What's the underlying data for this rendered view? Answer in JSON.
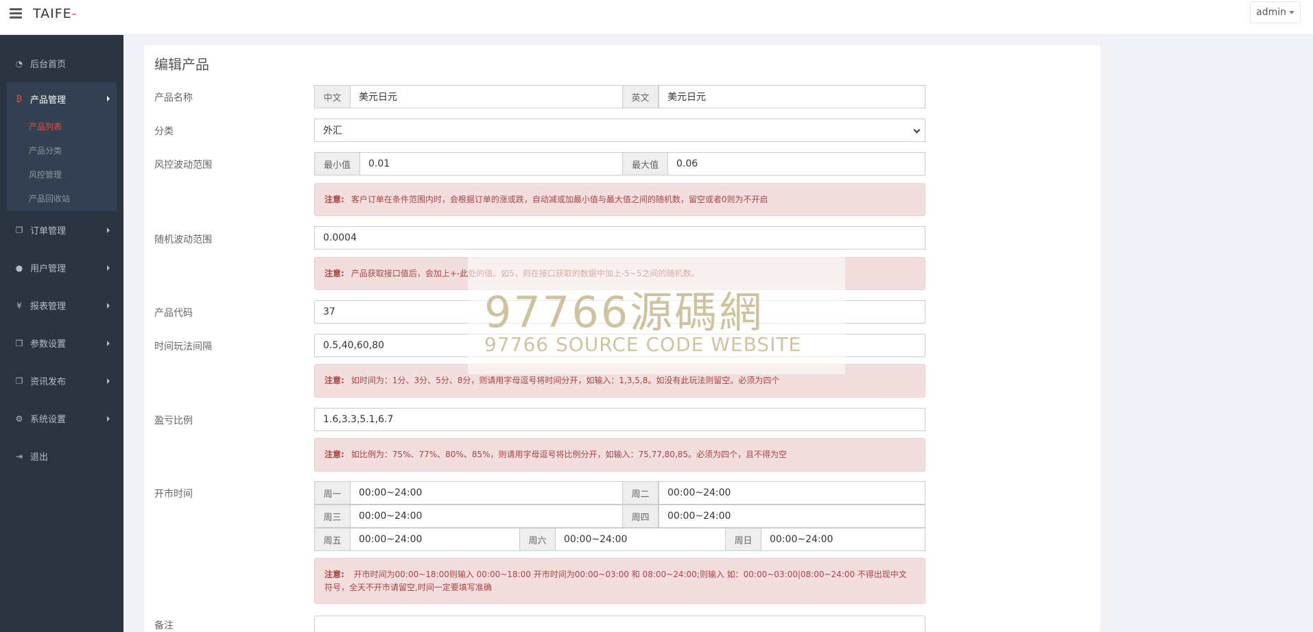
{
  "header": {
    "brand": "TAIFE",
    "brand_dash": "-",
    "user": "admin"
  },
  "sidebar": {
    "items": [
      {
        "label": "后台首页",
        "icon": "dashboard-icon"
      },
      {
        "label": "产品管理",
        "icon": "bitcoin-icon"
      },
      {
        "label": "订单管理",
        "icon": "copy-icon"
      },
      {
        "label": "用户管理",
        "icon": "user-icon"
      },
      {
        "label": "报表管理",
        "icon": "yen-icon"
      },
      {
        "label": "参数设置",
        "icon": "copy-icon"
      },
      {
        "label": "资讯发布",
        "icon": "copy-icon"
      },
      {
        "label": "系统设置",
        "icon": "cogs-icon"
      },
      {
        "label": "退出",
        "icon": "signout-icon"
      }
    ],
    "product_sub": [
      "产品列表",
      "产品分类",
      "风控管理",
      "产品回收站"
    ]
  },
  "form": {
    "title": "编辑产品",
    "name": {
      "label": "产品名称",
      "cn_addon": "中文",
      "cn_value": "美元日元",
      "en_addon": "英文",
      "en_value": "美元日元"
    },
    "category": {
      "label": "分类",
      "value": "外汇"
    },
    "risk": {
      "label": "风控波动范围",
      "min_addon": "最小值",
      "min_value": "0.01",
      "max_addon": "最大值",
      "max_value": "0.06",
      "note_strong": "注意:",
      "note": "客户订单在条件范围内时，会根据订单的涨或跌，自动减或加最小值与最大值之间的随机数，留空或者0则为不开启"
    },
    "random": {
      "label": "随机波动范围",
      "value": "0.0004",
      "note_strong": "注意:",
      "note": "产品获取接口值后，会加上+-此处的值。如5，则在接口获取的数据中加上-5~5之间的随机数。"
    },
    "code": {
      "label": "产品代码",
      "value": "37"
    },
    "interval": {
      "label": "时间玩法间隔",
      "value": "0.5,40,60,80",
      "note_strong": "注意:",
      "note": "如时间为：1分、3分、5分、8分，则请用字母逗号将时间分开，如输入：1,3,5,8。如没有此玩法则留空。必须为四个"
    },
    "profit": {
      "label": "盈亏比例",
      "value": "1.6,3.3,5.1,6.7",
      "note_strong": "注意:",
      "note": "如比例为：75%、77%、80%、85%，则请用字母逗号将比例分开，如输入：75,77,80,85。必须为四个，且不得为空"
    },
    "market": {
      "label": "开市时间",
      "days": [
        {
          "addon": "周一",
          "value": "00:00~24:00"
        },
        {
          "addon": "周二",
          "value": "00:00~24:00"
        },
        {
          "addon": "周三",
          "value": "00:00~24:00"
        },
        {
          "addon": "周四",
          "value": "00:00~24:00"
        },
        {
          "addon": "周五",
          "value": "00:00~24:00"
        },
        {
          "addon": "周六",
          "value": "00:00~24:00"
        },
        {
          "addon": "周日",
          "value": "00:00~24:00"
        }
      ],
      "note_strong": "注意:",
      "note_line1": "开市时间为00:00~18:00则输入 00:00~18:00 开市时间为00:00~03:00 和 08:00~24:00;则输入 如：00:00~03:00|08:00~24:00 不得出现中文",
      "note_line2": "符号，全天不开市请留空,时间一定要填写准确"
    },
    "remark": {
      "label": "备注"
    }
  },
  "watermark": {
    "big": "97766源碼網",
    "small": "97766 SOURCE CODE WEBSITE"
  }
}
